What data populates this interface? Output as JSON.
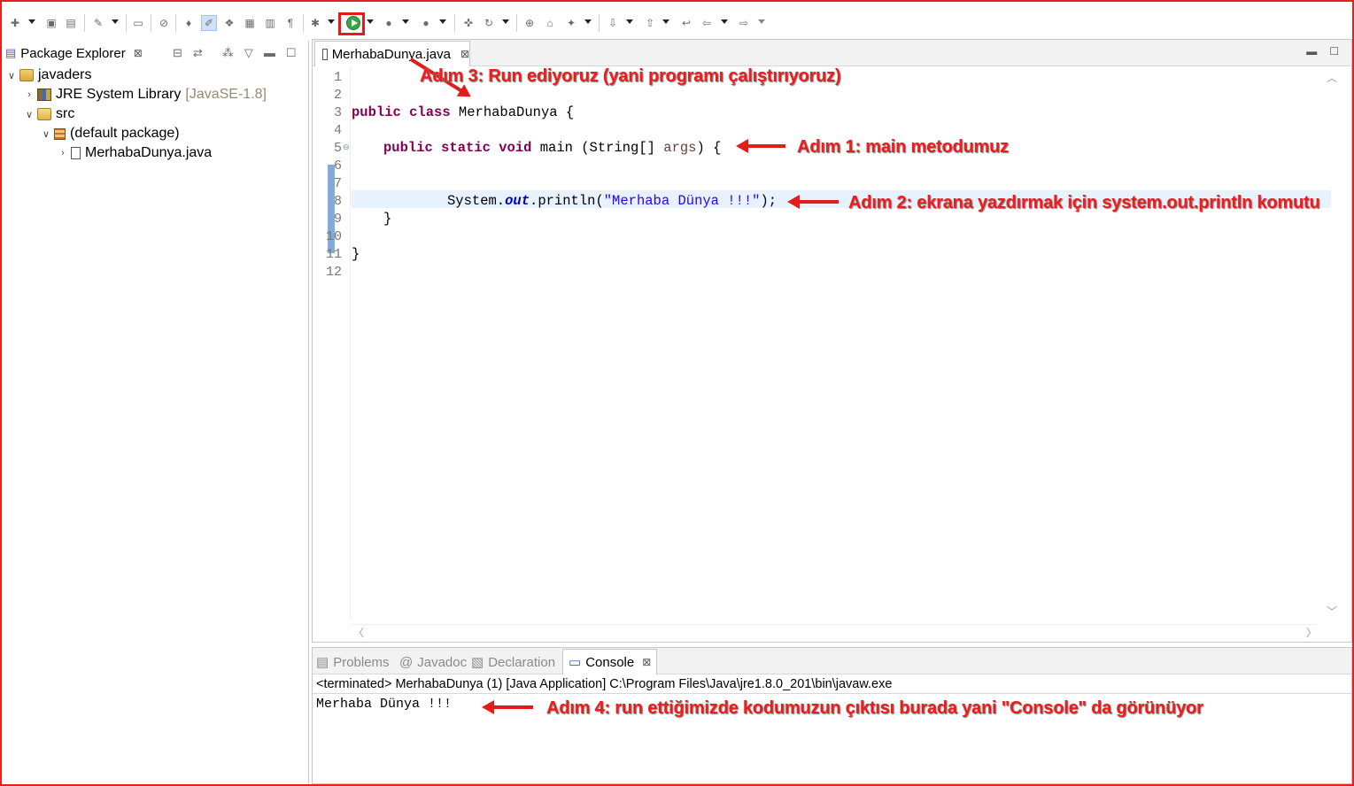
{
  "toolbar": {
    "buttons": [
      "new-icon",
      "save-icon",
      "save-all-icon",
      "build-icon",
      "terminal-icon",
      "skip-breakpoints-icon",
      "new-java-project-icon",
      "mark-occurrences-icon",
      "toggle-breadcrumb-icon",
      "show-whitespace-icon",
      "debug-icon",
      "run-icon",
      "coverage-icon",
      "external-tools-icon",
      "new-class-icon",
      "refresh-icon",
      "open-type-icon",
      "open-task-icon",
      "search-icon",
      "next-annotation-icon",
      "previous-annotation-icon",
      "last-edit-location-icon",
      "back-icon",
      "forward-icon"
    ],
    "highlight_color": "#e21b1b"
  },
  "package_explorer": {
    "title": "Package Explorer",
    "tree": [
      {
        "label": "javaders",
        "suffix": "",
        "icon": "project-icon",
        "depth": 0,
        "expanded": true
      },
      {
        "label": "JRE System Library",
        "suffix": "[JavaSE-1.8]",
        "icon": "library-icon",
        "depth": 1,
        "expanded": false
      },
      {
        "label": "src",
        "suffix": "",
        "icon": "source-folder-icon",
        "depth": 1,
        "expanded": true
      },
      {
        "label": "(default package)",
        "suffix": "",
        "icon": "package-icon",
        "depth": 2,
        "expanded": true
      },
      {
        "label": "MerhabaDunya.java",
        "suffix": "",
        "icon": "java-file-icon",
        "depth": 3,
        "expanded": false
      }
    ]
  },
  "editor": {
    "tab_label": "MerhabaDunya.java",
    "line_numbers": [
      "1",
      "2",
      "3",
      "4",
      "5",
      "6",
      "7",
      "8",
      "9",
      "10",
      "11",
      "12"
    ],
    "lines": {
      "l3_kw": "public class",
      "l3_rest": " MerhabaDunya {",
      "l5_kw": "public static void",
      "l5_mid": " main (String[] ",
      "l5_arg": "args",
      "l5_end": ") {",
      "l8_pre": "System.",
      "l8_field": "out",
      "l8_mid": ".println(",
      "l8_str": "\"Merhaba Dünya !!!\"",
      "l8_end": ");",
      "l9": "}",
      "l11": "}"
    }
  },
  "bottom": {
    "tabs": [
      "Problems",
      "Javadoc",
      "Declaration",
      "Console"
    ],
    "active_tab": "Console",
    "terminated": "<terminated> MerhabaDunya (1) [Java Application] C:\\Program Files\\Java\\jre1.8.0_201\\bin\\javaw.exe",
    "output": "Merhaba Dünya !!!"
  },
  "annotations": {
    "step1": "Adım 1: main metodumuz",
    "step2": "Adım 2: ekrana yazdırmak için system.out.println komutu",
    "step3": "Adım 3: Run ediyoruz (yani programı çalıştırıyoruz)",
    "step4": "Adım 4: run ettiğimizde kodumuzun çıktısı burada yani \"Console\" da görünüyor",
    "color": "#f21b1b"
  }
}
